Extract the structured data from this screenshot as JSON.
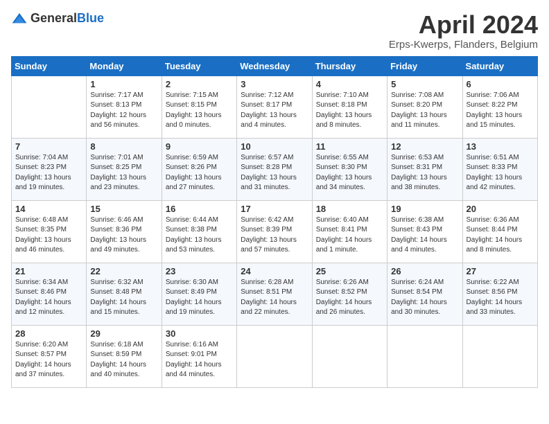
{
  "header": {
    "logo_general": "General",
    "logo_blue": "Blue",
    "title": "April 2024",
    "location": "Erps-Kwerps, Flanders, Belgium"
  },
  "weekdays": [
    "Sunday",
    "Monday",
    "Tuesday",
    "Wednesday",
    "Thursday",
    "Friday",
    "Saturday"
  ],
  "weeks": [
    [
      {
        "day": "",
        "info": ""
      },
      {
        "day": "1",
        "info": "Sunrise: 7:17 AM\nSunset: 8:13 PM\nDaylight: 12 hours\nand 56 minutes."
      },
      {
        "day": "2",
        "info": "Sunrise: 7:15 AM\nSunset: 8:15 PM\nDaylight: 13 hours\nand 0 minutes."
      },
      {
        "day": "3",
        "info": "Sunrise: 7:12 AM\nSunset: 8:17 PM\nDaylight: 13 hours\nand 4 minutes."
      },
      {
        "day": "4",
        "info": "Sunrise: 7:10 AM\nSunset: 8:18 PM\nDaylight: 13 hours\nand 8 minutes."
      },
      {
        "day": "5",
        "info": "Sunrise: 7:08 AM\nSunset: 8:20 PM\nDaylight: 13 hours\nand 11 minutes."
      },
      {
        "day": "6",
        "info": "Sunrise: 7:06 AM\nSunset: 8:22 PM\nDaylight: 13 hours\nand 15 minutes."
      }
    ],
    [
      {
        "day": "7",
        "info": "Sunrise: 7:04 AM\nSunset: 8:23 PM\nDaylight: 13 hours\nand 19 minutes."
      },
      {
        "day": "8",
        "info": "Sunrise: 7:01 AM\nSunset: 8:25 PM\nDaylight: 13 hours\nand 23 minutes."
      },
      {
        "day": "9",
        "info": "Sunrise: 6:59 AM\nSunset: 8:26 PM\nDaylight: 13 hours\nand 27 minutes."
      },
      {
        "day": "10",
        "info": "Sunrise: 6:57 AM\nSunset: 8:28 PM\nDaylight: 13 hours\nand 31 minutes."
      },
      {
        "day": "11",
        "info": "Sunrise: 6:55 AM\nSunset: 8:30 PM\nDaylight: 13 hours\nand 34 minutes."
      },
      {
        "day": "12",
        "info": "Sunrise: 6:53 AM\nSunset: 8:31 PM\nDaylight: 13 hours\nand 38 minutes."
      },
      {
        "day": "13",
        "info": "Sunrise: 6:51 AM\nSunset: 8:33 PM\nDaylight: 13 hours\nand 42 minutes."
      }
    ],
    [
      {
        "day": "14",
        "info": "Sunrise: 6:48 AM\nSunset: 8:35 PM\nDaylight: 13 hours\nand 46 minutes."
      },
      {
        "day": "15",
        "info": "Sunrise: 6:46 AM\nSunset: 8:36 PM\nDaylight: 13 hours\nand 49 minutes."
      },
      {
        "day": "16",
        "info": "Sunrise: 6:44 AM\nSunset: 8:38 PM\nDaylight: 13 hours\nand 53 minutes."
      },
      {
        "day": "17",
        "info": "Sunrise: 6:42 AM\nSunset: 8:39 PM\nDaylight: 13 hours\nand 57 minutes."
      },
      {
        "day": "18",
        "info": "Sunrise: 6:40 AM\nSunset: 8:41 PM\nDaylight: 14 hours\nand 1 minute."
      },
      {
        "day": "19",
        "info": "Sunrise: 6:38 AM\nSunset: 8:43 PM\nDaylight: 14 hours\nand 4 minutes."
      },
      {
        "day": "20",
        "info": "Sunrise: 6:36 AM\nSunset: 8:44 PM\nDaylight: 14 hours\nand 8 minutes."
      }
    ],
    [
      {
        "day": "21",
        "info": "Sunrise: 6:34 AM\nSunset: 8:46 PM\nDaylight: 14 hours\nand 12 minutes."
      },
      {
        "day": "22",
        "info": "Sunrise: 6:32 AM\nSunset: 8:48 PM\nDaylight: 14 hours\nand 15 minutes."
      },
      {
        "day": "23",
        "info": "Sunrise: 6:30 AM\nSunset: 8:49 PM\nDaylight: 14 hours\nand 19 minutes."
      },
      {
        "day": "24",
        "info": "Sunrise: 6:28 AM\nSunset: 8:51 PM\nDaylight: 14 hours\nand 22 minutes."
      },
      {
        "day": "25",
        "info": "Sunrise: 6:26 AM\nSunset: 8:52 PM\nDaylight: 14 hours\nand 26 minutes."
      },
      {
        "day": "26",
        "info": "Sunrise: 6:24 AM\nSunset: 8:54 PM\nDaylight: 14 hours\nand 30 minutes."
      },
      {
        "day": "27",
        "info": "Sunrise: 6:22 AM\nSunset: 8:56 PM\nDaylight: 14 hours\nand 33 minutes."
      }
    ],
    [
      {
        "day": "28",
        "info": "Sunrise: 6:20 AM\nSunset: 8:57 PM\nDaylight: 14 hours\nand 37 minutes."
      },
      {
        "day": "29",
        "info": "Sunrise: 6:18 AM\nSunset: 8:59 PM\nDaylight: 14 hours\nand 40 minutes."
      },
      {
        "day": "30",
        "info": "Sunrise: 6:16 AM\nSunset: 9:01 PM\nDaylight: 14 hours\nand 44 minutes."
      },
      {
        "day": "",
        "info": ""
      },
      {
        "day": "",
        "info": ""
      },
      {
        "day": "",
        "info": ""
      },
      {
        "day": "",
        "info": ""
      }
    ]
  ]
}
